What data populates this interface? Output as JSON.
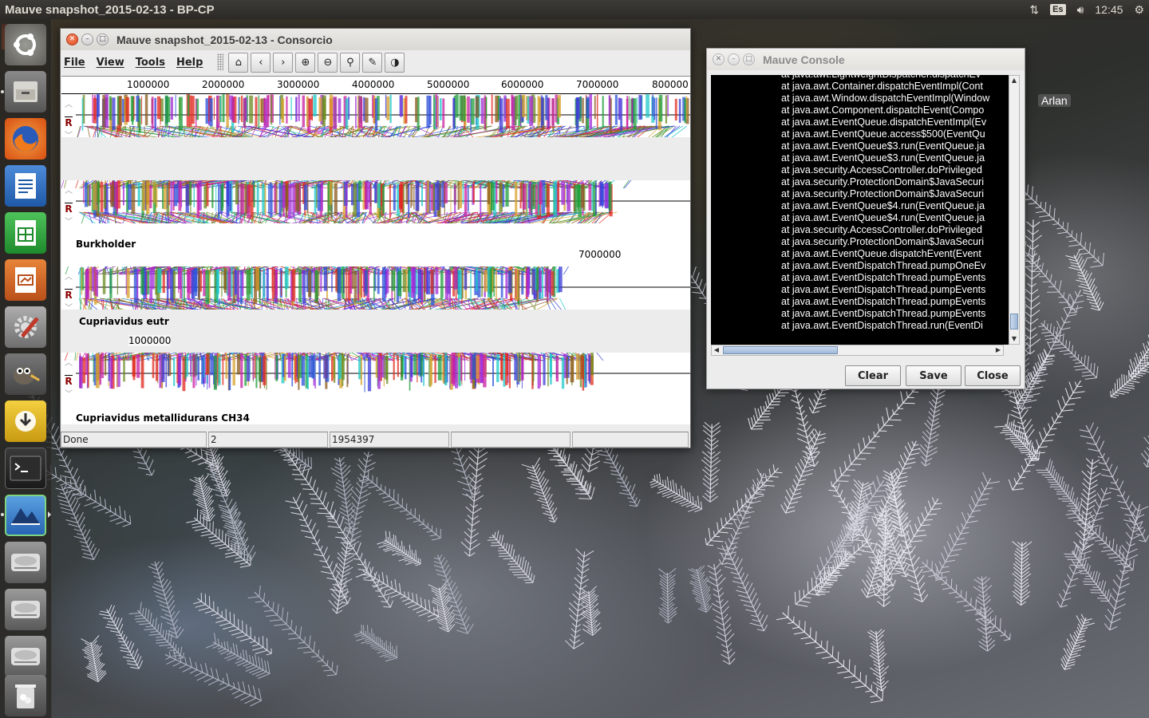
{
  "top_panel": {
    "title": "Mauve snapshot_2015-02-13 - BP-CP",
    "keyboard_layout": "Es",
    "clock": "12:45"
  },
  "desktop": {
    "folder_label": "Arlan"
  },
  "launcher": {
    "items": [
      {
        "name": "ubuntu-dash-icon"
      },
      {
        "name": "file-manager-icon"
      },
      {
        "name": "firefox-icon"
      },
      {
        "name": "libreoffice-writer-icon"
      },
      {
        "name": "libreoffice-calc-icon"
      },
      {
        "name": "libreoffice-impress-icon"
      },
      {
        "name": "system-settings-icon"
      },
      {
        "name": "gimp-icon"
      },
      {
        "name": "software-updater-icon"
      },
      {
        "name": "terminal-icon"
      },
      {
        "name": "mauve-icon"
      },
      {
        "name": "drive-icon"
      },
      {
        "name": "drive-icon"
      },
      {
        "name": "drive-icon"
      },
      {
        "name": "trash-icon"
      }
    ]
  },
  "mauve_window": {
    "title": "Mauve snapshot_2015-02-13 - Consorcio",
    "menu": [
      "File",
      "View",
      "Tools",
      "Help"
    ],
    "toolbar": [
      {
        "name": "home-icon",
        "glyph": "⌂"
      },
      {
        "name": "scroll-left-icon",
        "glyph": "‹"
      },
      {
        "name": "scroll-right-icon",
        "glyph": "›"
      },
      {
        "name": "zoom-in-icon",
        "glyph": "⊕"
      },
      {
        "name": "zoom-out-icon",
        "glyph": "⊖"
      },
      {
        "name": "search-icon",
        "glyph": "⚲"
      },
      {
        "name": "feature-icon",
        "glyph": "✎"
      },
      {
        "name": "color-icon",
        "glyph": "◑"
      }
    ],
    "ruler_ticks": [
      "1000000",
      "2000000",
      "3000000",
      "4000000",
      "5000000",
      "6000000",
      "7000000",
      "800000"
    ],
    "genomes": [
      {
        "label": "",
        "ruler": ""
      },
      {
        "label": "Burkholder",
        "ruler": "7000000"
      },
      {
        "label": "Cupriavidus eutr",
        "ruler": "1000000"
      },
      {
        "label": "",
        "ruler": ""
      },
      {
        "label": "Cupriavidus metallidurans CH34",
        "ruler": ""
      }
    ],
    "track_marker": "R",
    "status": [
      "Done",
      "2",
      "1954397",
      "",
      ""
    ]
  },
  "console_window": {
    "title": "Mauve Console",
    "lines": [
      "at java.awt.LightweightDispatcher.dispatchEv",
      "at java.awt.Container.dispatchEventImpl(Cont",
      "at java.awt.Window.dispatchEventImpl(Window",
      "at java.awt.Component.dispatchEvent(Compo",
      "at java.awt.EventQueue.dispatchEventImpl(Ev",
      "at java.awt.EventQueue.access$500(EventQu",
      "at java.awt.EventQueue$3.run(EventQueue.ja",
      "at java.awt.EventQueue$3.run(EventQueue.ja",
      "at java.security.AccessController.doPrivileged",
      "at java.security.ProtectionDomain$JavaSecuri",
      "at java.security.ProtectionDomain$JavaSecuri",
      "at java.awt.EventQueue$4.run(EventQueue.ja",
      "at java.awt.EventQueue$4.run(EventQueue.ja",
      "at java.security.AccessController.doPrivileged",
      "at java.security.ProtectionDomain$JavaSecuri",
      "at java.awt.EventQueue.dispatchEvent(Event",
      "at java.awt.EventDispatchThread.pumpOneEv",
      "at java.awt.EventDispatchThread.pumpEvents",
      "at java.awt.EventDispatchThread.pumpEvents",
      "at java.awt.EventDispatchThread.pumpEvents",
      "at java.awt.EventDispatchThread.pumpEvents",
      "at java.awt.EventDispatchThread.run(EventDi"
    ],
    "buttons": {
      "clear": "Clear",
      "save": "Save",
      "close": "Close"
    }
  },
  "colors": {
    "panel_bg": "#2b2a27",
    "accent_orange": "#e95420",
    "lcb_palette": [
      "#e0281e",
      "#1e9e3a",
      "#2a4fd8",
      "#a02ad8",
      "#d8a02a",
      "#1ec8c8",
      "#c81ea0",
      "#6a8a1e",
      "#8a5a1e",
      "#3a3ad8"
    ]
  }
}
